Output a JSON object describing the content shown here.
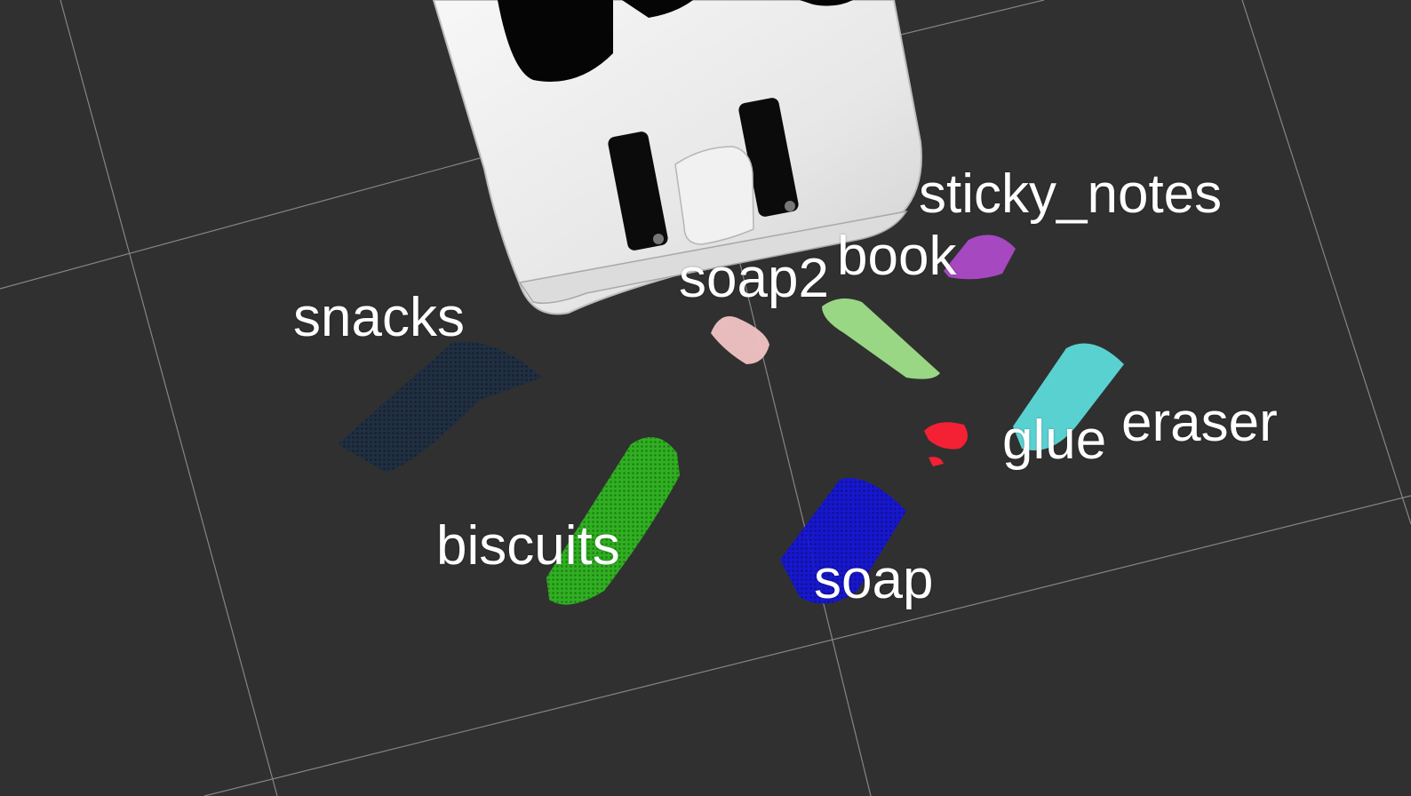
{
  "viewer": {
    "background_color": "#303030",
    "grid_color": "#9a9a9a",
    "robot_color": "#e8e8e8"
  },
  "objects": [
    {
      "id": "sticky_notes",
      "label": "sticky_notes",
      "color": "#b44bd0"
    },
    {
      "id": "book",
      "label": "book",
      "color": "#b44bd0"
    },
    {
      "id": "soap2",
      "label": "soap2",
      "color": "#f2c4c4"
    },
    {
      "id": "snacks",
      "label": "snacks",
      "color": "#1d2f45"
    },
    {
      "id": "eraser",
      "label": "eraser",
      "color": "#5fe3e3"
    },
    {
      "id": "glue",
      "label": "glue",
      "color": "#ff2035"
    },
    {
      "id": "biscuits",
      "label": "biscuits",
      "color": "#2fc21f"
    },
    {
      "id": "soap",
      "label": "soap",
      "color": "#1515e0"
    },
    {
      "id": "book_cloud",
      "label": "",
      "color": "#a6ea8e"
    }
  ]
}
